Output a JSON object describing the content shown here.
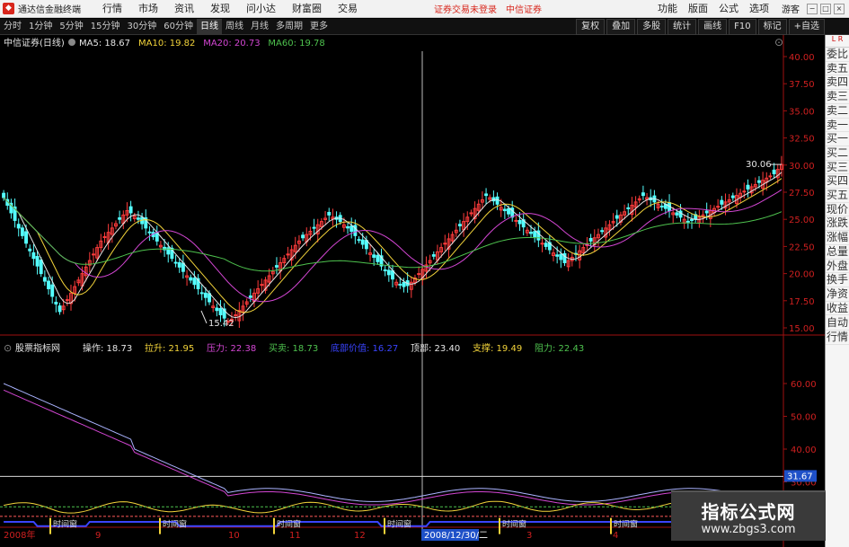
{
  "app": {
    "title": "通达信金融终端"
  },
  "menu": [
    "行情",
    "市场",
    "资讯",
    "发现",
    "问小达",
    "财富圈",
    "交易"
  ],
  "status": {
    "login": "证券交易未登录",
    "broker": "中信证券"
  },
  "right_menu": [
    "功能",
    "版面",
    "公式",
    "选项"
  ],
  "guest": "游客",
  "periods": {
    "items": [
      "分时",
      "1分钟",
      "5分钟",
      "15分钟",
      "30分钟",
      "60分钟",
      "日线",
      "周线",
      "月线",
      "多周期",
      "更多"
    ],
    "active": "日线"
  },
  "tools": [
    "复权",
    "叠加",
    "多股",
    "统计",
    "画线",
    "F10",
    "标记",
    "+自选"
  ],
  "sidebar": {
    "tag": "L R",
    "items": [
      "委比",
      "卖五",
      "卖四",
      "卖三",
      "卖二",
      "卖一",
      "买一",
      "买二",
      "买三",
      "买四",
      "买五",
      "现价",
      "涨跌",
      "涨幅",
      "总量",
      "外盘",
      "换手",
      "净资",
      "收益"
    ],
    "lower": [
      "自动",
      "行情"
    ]
  },
  "upper": {
    "title": "中信证券(日线)",
    "ma": [
      {
        "name": "MA5",
        "value": "18.67",
        "color": "#e6e6e6"
      },
      {
        "name": "MA10",
        "value": "19.82",
        "color": "#f2d33a"
      },
      {
        "name": "MA20",
        "value": "20.73",
        "color": "#d346d3"
      },
      {
        "name": "MA60",
        "value": "19.78",
        "color": "#4ec24e"
      }
    ],
    "ticks": [
      "40.00",
      "37.50",
      "35.00",
      "32.50",
      "30.00",
      "27.50",
      "25.00",
      "22.50",
      "20.00",
      "17.50",
      "15.00"
    ],
    "annotations": {
      "low": "15.42",
      "high": "30.06"
    }
  },
  "lower": {
    "title": "股票指标网",
    "fields": [
      {
        "label": "操作:",
        "value": "18.73",
        "color": "#e6e6e6"
      },
      {
        "label": "拉升:",
        "value": "21.95",
        "color": "#f2d33a"
      },
      {
        "label": "压力:",
        "value": "22.38",
        "color": "#d346d3"
      },
      {
        "label": "买卖:",
        "value": "18.73",
        "color": "#4ec24e"
      },
      {
        "label": "底部价值:",
        "value": "16.27",
        "color": "#3a44ff"
      },
      {
        "label": "顶部:",
        "value": "23.40",
        "color": "#e6e6e6"
      },
      {
        "label": "支撑:",
        "value": "19.49",
        "color": "#f2d33a"
      },
      {
        "label": "阻力:",
        "value": "22.43",
        "color": "#4ec24e"
      }
    ],
    "ticks": [
      "60.00",
      "50.00",
      "40.00",
      "30.00",
      "20.00"
    ],
    "current_value": "31.67",
    "marker_label": "时间窗"
  },
  "xaxis": [
    "2008年",
    "9",
    "10",
    "11",
    "12",
    "2008/12/30/二",
    "3",
    "4",
    "5"
  ],
  "crosshair": {
    "date": "2008/12/30/二"
  },
  "watermark": {
    "line1": "指标公式网",
    "line2": "www.zbgs3.com"
  },
  "colors": {
    "up": "#ff3c3c",
    "down": "#54ffff",
    "ma5": "#e6e6e6",
    "ma10": "#f2d33a",
    "ma20": "#d346d3",
    "ma60": "#4ec24e",
    "ref": "#aaaaaa",
    "blue": "#3a44ff"
  },
  "chart_data": {
    "type": "candlestick",
    "price_axis": {
      "ylim": [
        15.0,
        40.0
      ]
    },
    "annotations": [
      {
        "label": "15.42",
        "value": 15.42
      },
      {
        "label": "30.06",
        "value": 30.06
      }
    ],
    "closes": [
      27.0,
      26.3,
      25.6,
      24.9,
      24.2,
      23.5,
      22.8,
      22.1,
      21.4,
      20.7,
      20.0,
      19.3,
      18.6,
      17.9,
      17.2,
      16.5,
      17.0,
      17.6,
      18.2,
      18.8,
      19.4,
      20.0,
      20.6,
      21.2,
      21.8,
      22.4,
      23.0,
      23.4,
      23.8,
      24.2,
      24.6,
      25.0,
      25.4,
      25.8,
      25.6,
      25.3,
      25.0,
      24.6,
      24.2,
      23.8,
      23.4,
      23.0,
      22.6,
      22.2,
      21.8,
      21.4,
      21.0,
      20.6,
      20.2,
      19.8,
      19.4,
      19.0,
      18.6,
      18.2,
      17.8,
      17.4,
      17.0,
      16.6,
      16.2,
      15.9,
      15.6,
      15.8,
      16.2,
      16.6,
      17.0,
      17.4,
      17.8,
      18.2,
      18.6,
      19.0,
      19.4,
      19.8,
      20.2,
      20.6,
      21.0,
      21.4,
      21.8,
      22.2,
      22.6,
      23.0,
      23.3,
      23.6,
      23.9,
      24.2,
      24.5,
      24.8,
      25.1,
      25.4,
      25.2,
      25.0,
      24.8,
      24.5,
      24.2,
      23.9,
      23.5,
      23.1,
      22.7,
      22.3,
      21.9,
      21.5,
      21.1,
      20.7,
      20.3,
      19.9,
      19.5,
      19.2,
      19.0,
      18.8,
      18.9,
      19.2,
      19.6,
      20.0,
      20.4,
      20.8,
      21.2,
      21.6,
      22.0,
      22.4,
      22.8,
      23.2,
      23.6,
      24.0,
      24.4,
      24.8,
      25.2,
      25.6,
      26.0,
      26.4,
      26.8,
      27.2,
      27.0,
      26.7,
      26.4,
      26.1,
      25.8,
      25.5,
      25.2,
      24.9,
      24.6,
      24.3,
      24.0,
      23.7,
      23.4,
      23.1,
      22.8,
      22.5,
      22.2,
      21.9,
      21.6,
      21.3,
      21.0,
      21.2,
      21.5,
      21.8,
      22.1,
      22.4,
      22.7,
      23.0,
      23.3,
      23.6,
      23.9,
      24.2,
      24.5,
      24.8,
      25.1,
      25.4,
      25.7,
      26.0,
      26.3,
      26.6,
      26.9,
      27.2,
      27.0,
      26.8,
      26.6,
      26.4,
      26.2,
      26.0,
      25.8,
      25.6,
      25.4,
      25.2,
      25.0,
      24.8,
      24.9,
      25.0,
      25.2,
      25.4,
      25.6,
      25.8,
      26.0,
      26.2,
      26.4,
      26.6,
      26.8,
      27.0,
      27.2,
      27.4,
      27.6,
      27.8,
      28.0,
      28.2,
      28.4,
      28.6,
      28.8,
      29.0,
      29.2,
      29.6,
      30.06
    ]
  }
}
